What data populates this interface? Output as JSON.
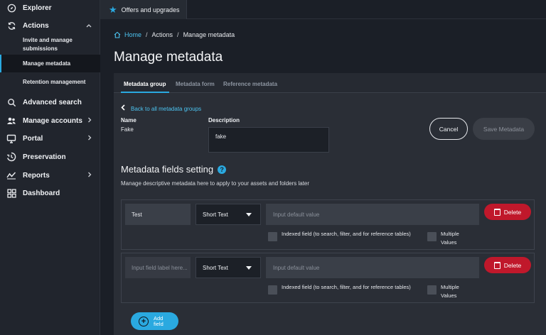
{
  "sidebar": {
    "items": [
      {
        "label": "Explorer",
        "icon": "compass-icon"
      },
      {
        "label": "Actions",
        "icon": "sync-icon",
        "expanded": true,
        "children": [
          {
            "label": "Invite and manage submissions"
          },
          {
            "label": "Manage metadata",
            "active": true
          },
          {
            "label": "Retention management"
          }
        ]
      },
      {
        "label": "Advanced search",
        "icon": "search-icon"
      },
      {
        "label": "Manage accounts",
        "icon": "people-icon"
      },
      {
        "label": "Portal",
        "icon": "monitor-icon"
      },
      {
        "label": "Preservation",
        "icon": "preservation-icon"
      },
      {
        "label": "Reports",
        "icon": "chart-line-icon"
      },
      {
        "label": "Dashboard",
        "icon": "grid-icon"
      }
    ]
  },
  "topbar": {
    "offers_label": "Offers and upgrades"
  },
  "breadcrumb": {
    "home": "Home",
    "actions": "Actions",
    "current": "Manage metadata"
  },
  "page": {
    "title": "Manage metadata"
  },
  "tabs": [
    "Metadata group",
    "Metadata form",
    "Reference metadata"
  ],
  "group": {
    "back_link": "Back to all metadata groups",
    "name_label": "Name",
    "name_value": "Fake",
    "description_label": "Description",
    "description_value": "fake",
    "cancel_label": "Cancel",
    "save_label": "Save Metadata"
  },
  "fields_section": {
    "title": "Metadata fields setting",
    "description": "Manage descriptive metadata here to apply to your assets and folders later",
    "rows": [
      {
        "label_value": "Test",
        "label_placeholder": "Input field label here...",
        "type": "Short Text",
        "default_placeholder": "Input default value",
        "delete_label": "Delete",
        "indexed_label": "Indexed field (to search, filter, and for reference tables)",
        "multiple_label": "Multiple Values"
      },
      {
        "label_value": "",
        "label_placeholder": "Input field label here...",
        "type": "Short Text",
        "default_placeholder": "Input default value",
        "delete_label": "Delete",
        "indexed_label": "Indexed field (to search, filter, and for reference tables)",
        "multiple_label": "Multiple Values"
      }
    ],
    "add_label_line1": "Add",
    "add_label_line2": "field"
  },
  "colors": {
    "accent": "#2aa9e0",
    "danger": "#c0182b",
    "background": "#1b1f27",
    "panel": "#2a2e36"
  }
}
